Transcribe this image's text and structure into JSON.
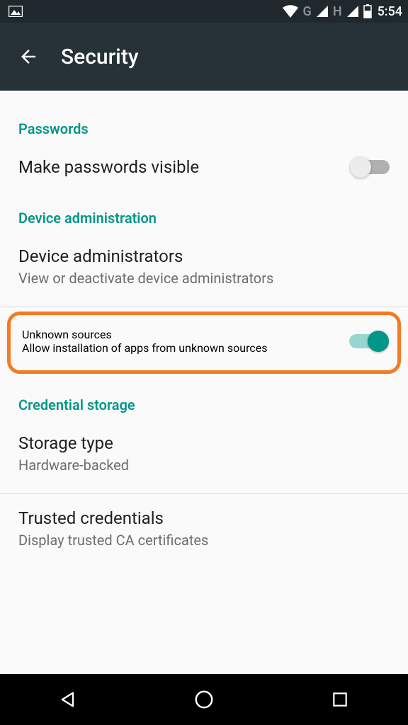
{
  "statusbar": {
    "net1": "G",
    "net2": "H",
    "time": "5:54"
  },
  "header": {
    "title": "Security"
  },
  "sections": {
    "passwords_label": "Passwords",
    "device_admin_label": "Device administration",
    "credential_storage_label": "Credential storage"
  },
  "rows": {
    "make_passwords_visible": {
      "title": "Make passwords visible"
    },
    "device_administrators": {
      "title": "Device administrators",
      "subtitle": "View or deactivate device administrators"
    },
    "unknown_sources": {
      "title": "Unknown sources",
      "subtitle": "Allow installation of apps from unknown sources"
    },
    "storage_type": {
      "title": "Storage type",
      "subtitle": "Hardware-backed"
    },
    "trusted_credentials": {
      "title": "Trusted credentials",
      "subtitle": "Display trusted CA certificates"
    }
  }
}
